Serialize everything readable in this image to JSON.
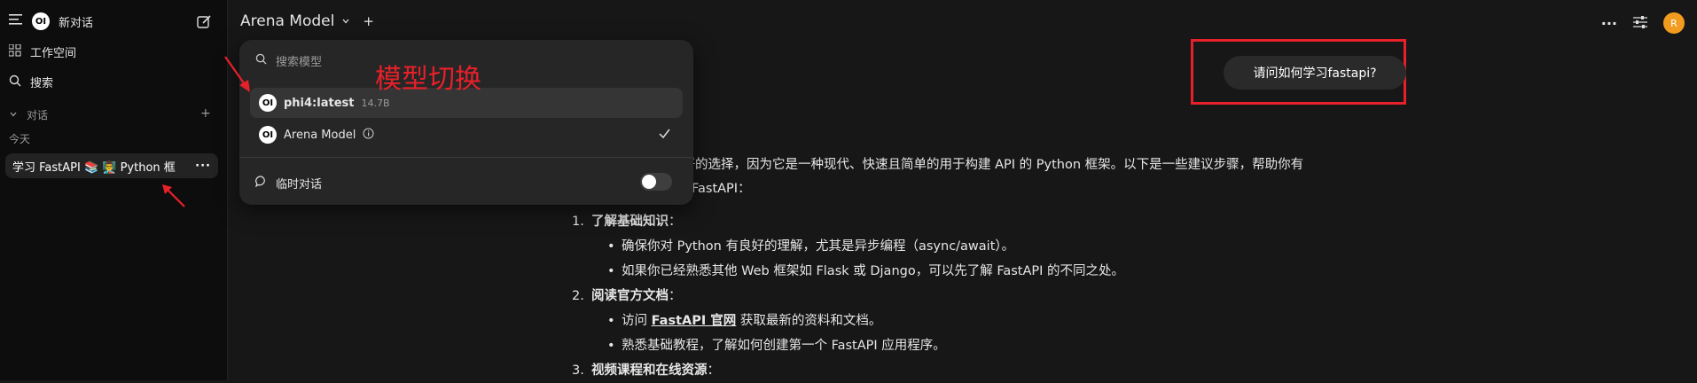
{
  "sidebar": {
    "new_chat": "新对话",
    "workspace": "工作空间",
    "search": "搜索",
    "section": "对话",
    "today": "今天",
    "chat_item": "学习 FastAPI 📚 👨‍🏫 Python 框",
    "logo_text": "OI"
  },
  "topbar": {
    "model": "Arena Model",
    "avatar_letter": "R"
  },
  "dropdown": {
    "search_placeholder": "搜索模型",
    "items": [
      {
        "name": "phi4:latest",
        "size": "14.7B"
      },
      {
        "name": "Arena Model"
      }
    ],
    "temp_chat": "临时对话"
  },
  "annotation": "模型切换",
  "chat": {
    "user_msg": "请问如何学习fastapi?",
    "intro_line1": "很好的选择，因为它是一种现代、快速且简单的用于构建 API 的 Python 框架。以下是一些建议步骤，帮助你有",
    "intro_line2": "FastAPI：",
    "sec1": {
      "num": "1.",
      "title": "了解基础知识",
      "colon": "："
    },
    "b1": "确保你对 Python 有良好的理解，尤其是异步编程（async/await）。",
    "b2": "如果你已经熟悉其他 Web 框架如 Flask 或 Django，可以先了解 FastAPI 的不同之处。",
    "sec2": {
      "num": "2.",
      "title": "阅读官方文档",
      "colon": "："
    },
    "b3_pre": "访问 ",
    "b3_link": "FastAPI 官网",
    "b3_post": " 获取最新的资料和文档。",
    "b4": "熟悉基础教程，了解如何创建第一个 FastAPI 应用程序。",
    "sec3": {
      "num": "3.",
      "title": "视频课程和在线资源",
      "colon": "："
    }
  },
  "colors": {
    "accent": "#e8202a",
    "avatar": "#f29c1f",
    "background": "#171717",
    "sidebar": "#0d0d0d"
  }
}
